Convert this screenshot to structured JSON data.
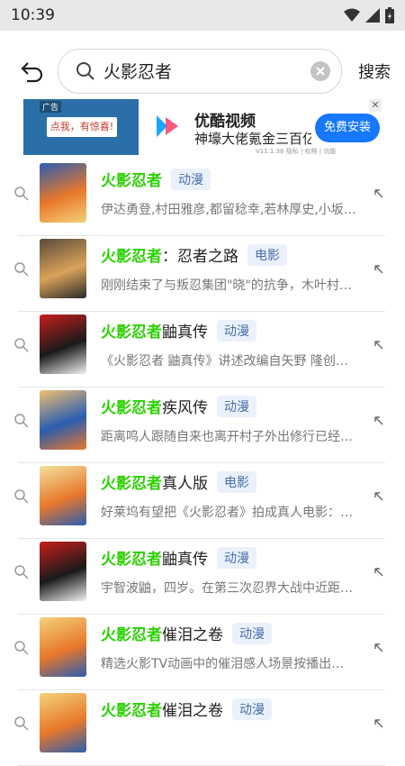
{
  "status": {
    "time": "10:39"
  },
  "search": {
    "query": "火影忍者",
    "button_label": "搜索"
  },
  "ad": {
    "tag": "广告",
    "banner_text": "点我，有惊喜!",
    "app_name": "优酷视频",
    "slogan": "神壕大佬氪金三百亿",
    "meta": "V11.1.38 隐私 | 权限 | 功能",
    "install_label": "免费安装",
    "close_symbol": "✕"
  },
  "results": [
    {
      "highlight": "火影忍者",
      "rest": "",
      "badge": "动漫",
      "desc": "伊达勇登,村田雅彦,都留稔幸,若林厚史,小坂…",
      "colors": [
        "#2a5db0",
        "#e8782a",
        "#f3d27a"
      ]
    },
    {
      "highlight": "火影忍者",
      "rest": "：忍者之路",
      "badge": "电影",
      "desc": "刚刚结束了与叛忍集团\"晓\"的抗争，木叶村…",
      "colors": [
        "#5a4a3a",
        "#d9a35a",
        "#2a2a2a"
      ]
    },
    {
      "highlight": "火影忍者",
      "rest": " 鼬真传",
      "badge": "动漫",
      "desc": "《火影忍者 鼬真传》讲述改编自矢野 隆创…",
      "colors": [
        "#c81e1e",
        "#1a1a1a",
        "#f2f2f2"
      ]
    },
    {
      "highlight": "火影忍者",
      "rest": "疾风传",
      "badge": "动漫",
      "desc": "距离鸣人跟随自来也离开村子外出修行已经…",
      "colors": [
        "#f0c070",
        "#2a5db0",
        "#e8782a"
      ]
    },
    {
      "highlight": "火影忍者",
      "rest": "真人版",
      "badge": "电影",
      "desc": "好莱坞有望把《火影忍者》拍成真人电影：…",
      "colors": [
        "#f2e2a0",
        "#e8782a",
        "#2a5db0"
      ]
    },
    {
      "highlight": "火影忍者",
      "rest": "鼬真传",
      "badge": "动漫",
      "desc": "宇智波鼬，四岁。在第三次忍界大战中近距…",
      "colors": [
        "#c81e1e",
        "#1a1a1a",
        "#f2f2f2"
      ]
    },
    {
      "highlight": "火影忍者",
      "rest": "催泪之卷",
      "badge": "动漫",
      "desc": "精选火影TV动画中的催泪感人场景按播出…",
      "colors": [
        "#f3d27a",
        "#e8782a",
        "#2a5db0"
      ]
    },
    {
      "highlight": "火影忍者",
      "rest": " 催泪之卷",
      "badge": "动漫",
      "desc": "",
      "colors": [
        "#f3d27a",
        "#e8782a",
        "#2a5db0"
      ]
    }
  ],
  "icons": {
    "back": "back-arrow-icon",
    "search": "search-icon",
    "clear": "clear-icon",
    "fill_suggestion": "arrow-up-left-icon"
  }
}
